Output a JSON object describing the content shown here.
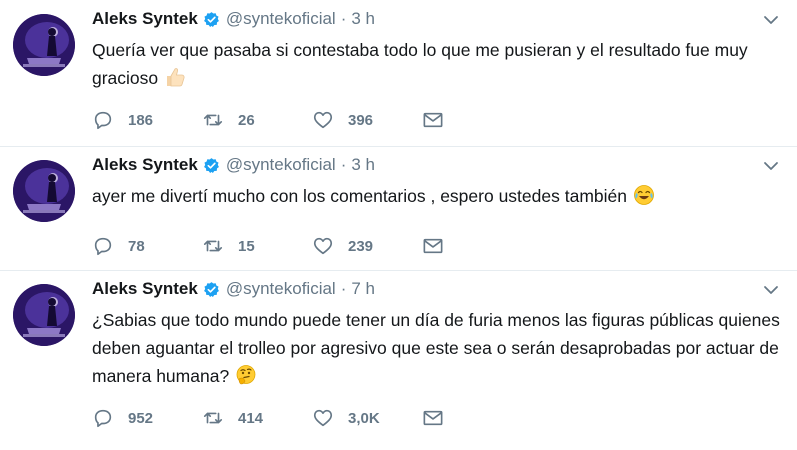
{
  "colors": {
    "verified_blue": "#1da1f2",
    "meta_gray": "#657786",
    "text_dark": "#14171a",
    "divider": "#e6ecf0"
  },
  "tweets": [
    {
      "name": "Aleks Syntek",
      "handle": "@syntekoficial",
      "separator": "·",
      "time": "3 h",
      "text": "Quería ver que pasaba si contestaba todo lo que me pusieran y el resultado fue muy gracioso",
      "emoji": "thumbs-up-emoji",
      "replies": "186",
      "retweets": "26",
      "likes": "396"
    },
    {
      "name": "Aleks Syntek",
      "handle": "@syntekoficial",
      "separator": "·",
      "time": "3 h",
      "text": "ayer me divertí mucho con los comentarios , espero ustedes también",
      "emoji": "tears-of-joy-emoji",
      "replies": "78",
      "retweets": "15",
      "likes": "239"
    },
    {
      "name": "Aleks Syntek",
      "handle": "@syntekoficial",
      "separator": "·",
      "time": "7 h",
      "text": "¿Sabias que todo mundo puede tener un día de furia menos las figuras públicas quienes deben aguantar el trolleo por agresivo que este sea o serán desaprobadas por actuar de manera humana?",
      "emoji": "thinking-face-emoji",
      "replies": "952",
      "retweets": "414",
      "likes": "3,0K"
    }
  ]
}
